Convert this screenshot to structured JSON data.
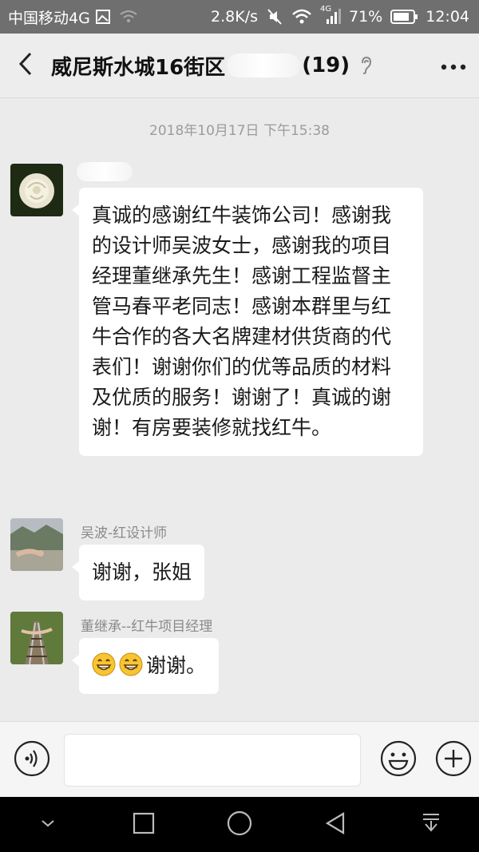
{
  "status_bar": {
    "carrier": "中国移动4G",
    "speed": "2.8K/s",
    "network": "4G",
    "battery": "71%",
    "time": "12:04"
  },
  "header": {
    "title_prefix": "威尼斯水城16街区",
    "member_count": "(19)"
  },
  "chat": {
    "timestamp": "2018年10月17日 下午15:38",
    "messages": [
      {
        "sender": "",
        "text": "真诚的感谢红牛装饰公司！感谢我的设计师吴波女士，感谢我的项目经理董继承先生！感谢工程监督主管马春平老同志！感谢本群里与红牛合作的各大名牌建材供货商的代表们！谢谢你们的优等品质的材料及优质的服务！谢谢了！真诚的谢谢！有房要装修就找红牛。"
      },
      {
        "sender": "吴波-红设计师",
        "text": "谢谢，张姐"
      },
      {
        "sender": "董继承--红牛项目经理",
        "text": "谢谢。"
      }
    ]
  },
  "colors": {
    "status_bar_bg": "#6f6f6f",
    "chat_bg": "#ebebeb",
    "bubble_bg": "#ffffff",
    "nav_bg": "#000000"
  },
  "icons": [
    "back-icon",
    "ear-icon",
    "more-icon",
    "voice-icon",
    "emoji-icon",
    "plus-icon"
  ]
}
